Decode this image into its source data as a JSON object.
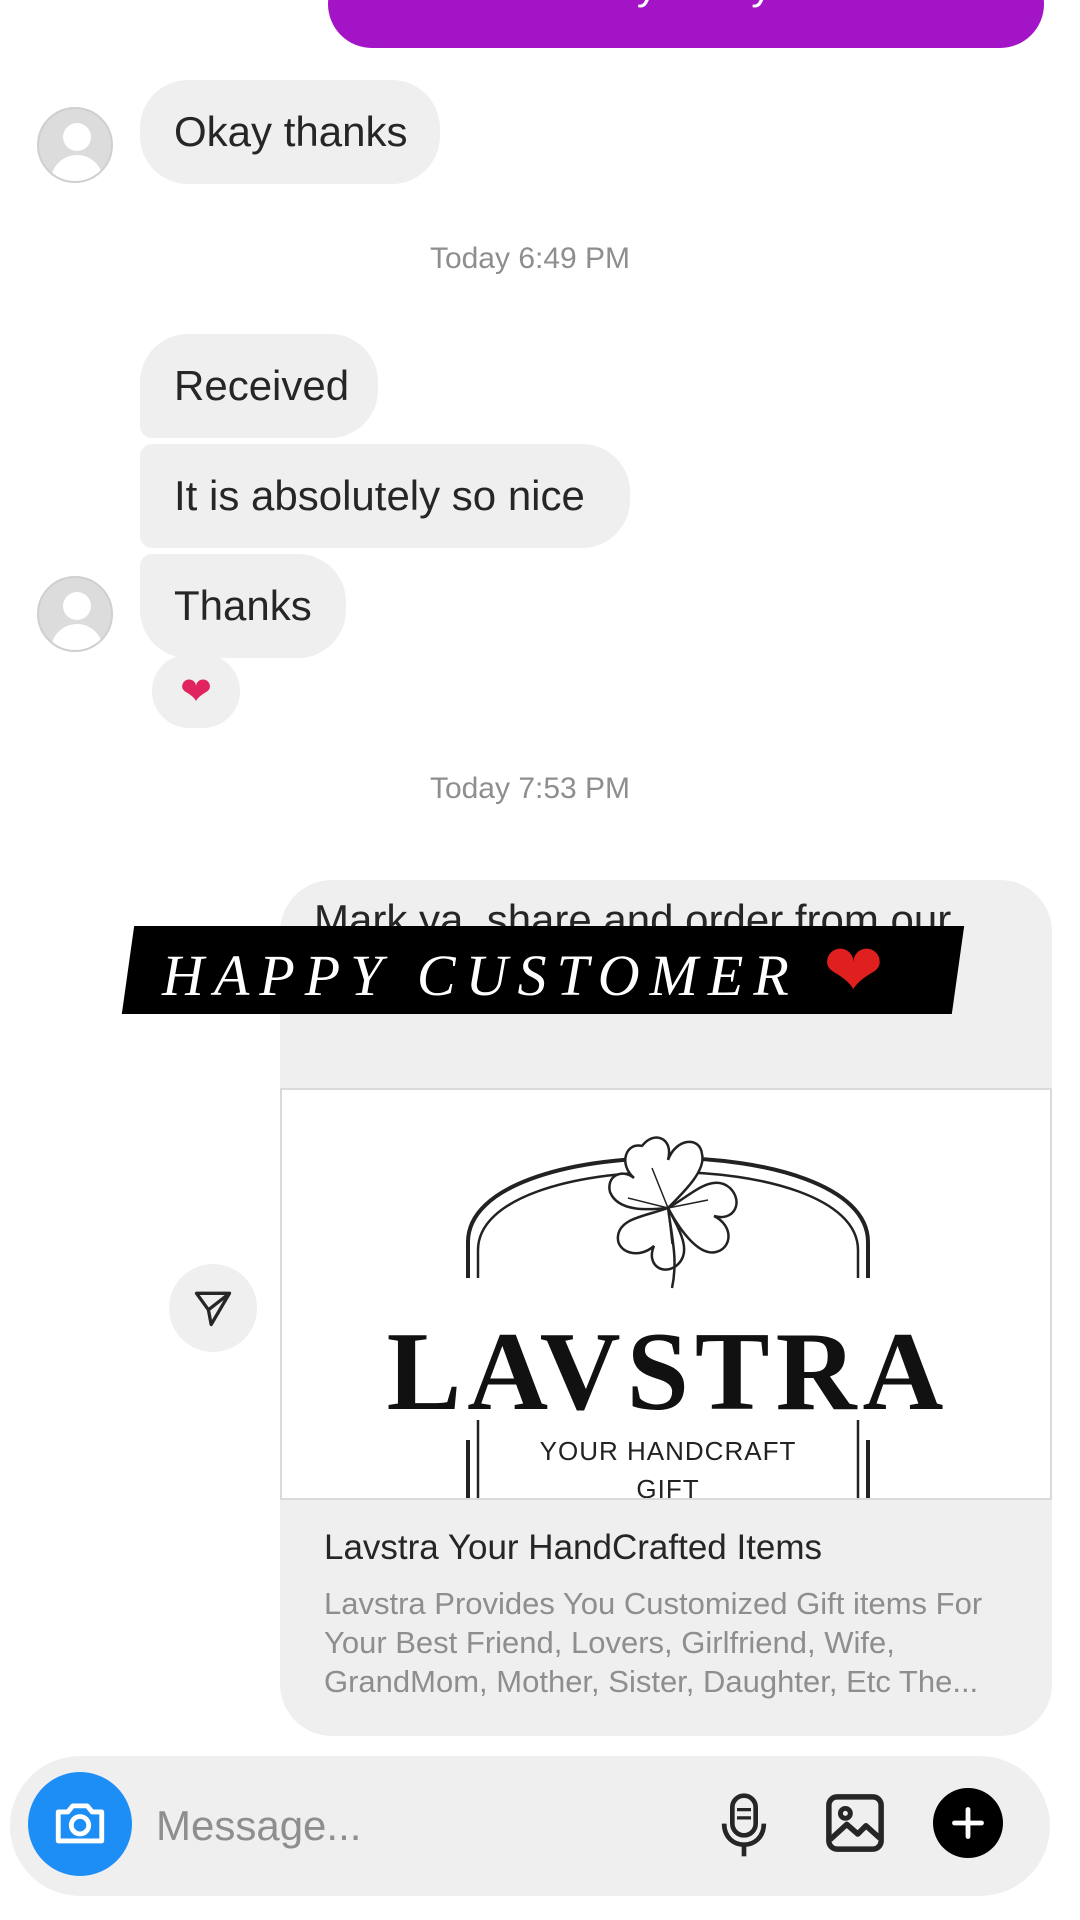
{
  "thread": {
    "outgoing_top": "You receive by today or tomorrow",
    "msg_okay": "Okay thanks",
    "timestamp_1": "Today 6:49 PM",
    "msg_received": "Received",
    "msg_nice": "It is absolutely so nice",
    "msg_thanks": "Thanks",
    "reaction": "❤",
    "timestamp_2": "Today 7:53 PM"
  },
  "share": {
    "text": "Mark ya, share and order from our shop more 🥰",
    "brand": "LAVSTRA",
    "tagline_line1": "YOUR HANDCRAFT",
    "tagline_line2": "GIFT",
    "link_title": "Lavstra Your HandCrafted Items",
    "link_description": "Lavstra Provides You Customized Gift items For Your Best Friend, Lovers, Girlfriend, Wife, GrandMom, Mother, Sister, Daughter, Etc The..."
  },
  "overlay": {
    "banner_text": "HAPPY CUSTOMER",
    "banner_heart": "❤"
  },
  "composer": {
    "placeholder": "Message..."
  },
  "colors": {
    "sent_bubble": "#a314c6",
    "received_bubble": "#efefef",
    "camera_button": "#1c8ef5",
    "heart": "#e0245e"
  },
  "icons": [
    "camera-icon",
    "microphone-icon",
    "gallery-icon",
    "plus-icon",
    "send-icon",
    "user-avatar"
  ]
}
